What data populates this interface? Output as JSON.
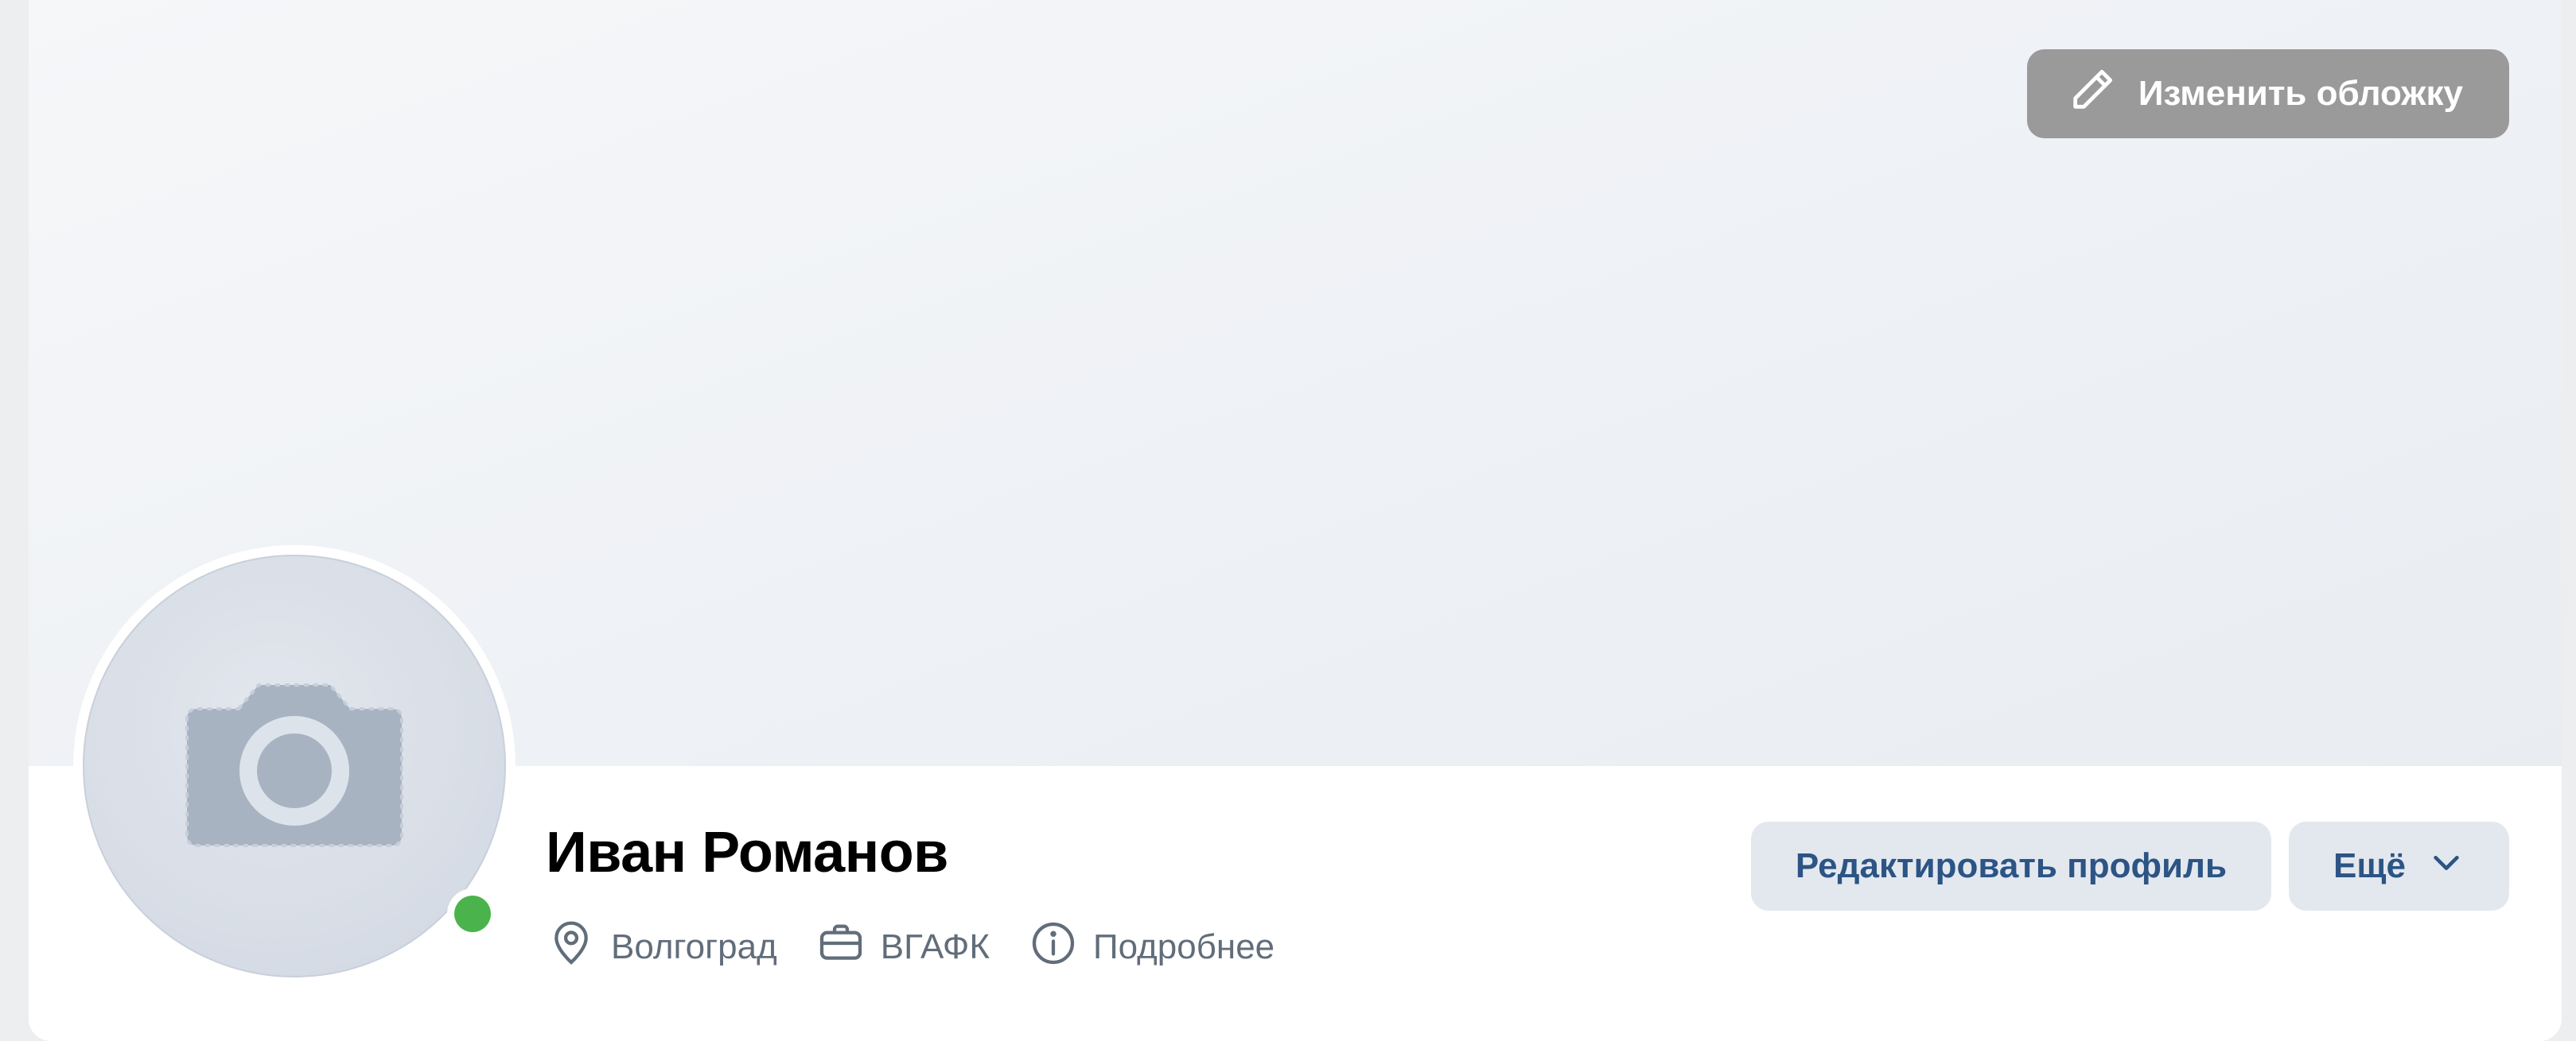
{
  "cover": {
    "edit_button_label": "Изменить обложку",
    "icon": "pencil-icon"
  },
  "profile": {
    "name": "Иван Романов",
    "online": true,
    "avatar_icon": "camera-icon"
  },
  "meta": {
    "city": "Волгоград",
    "work": "ВГАФК",
    "details_link": "Подробнее",
    "icons": [
      "location-pin-icon",
      "briefcase-icon",
      "info-icon"
    ]
  },
  "actions": {
    "edit_profile_label": "Редактировать профиль",
    "more_label": "Ещё",
    "more_icon": "chevron-down-icon"
  },
  "colors": {
    "online": "#4bb34b",
    "button_bg": "#e3e8ef",
    "button_text": "#2c5484",
    "cover_button_bg": "#9a9a9a",
    "meta_text": "#626d7a"
  }
}
